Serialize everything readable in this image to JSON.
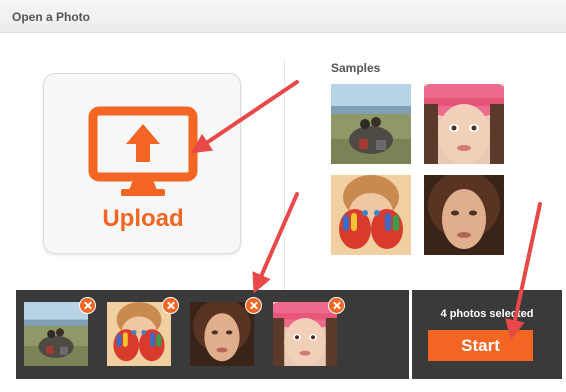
{
  "title": "Open a Photo",
  "upload": {
    "label": "Upload",
    "icon": "monitor-upload-icon",
    "accent": "#f26522"
  },
  "samples": {
    "label": "Samples",
    "items": [
      {
        "name": "sample-people-field"
      },
      {
        "name": "sample-girl-pink-hat"
      },
      {
        "name": "sample-painted-hands"
      },
      {
        "name": "sample-woman-portrait"
      }
    ]
  },
  "tray": {
    "photos": [
      {
        "name": "people-field"
      },
      {
        "name": "painted-hands"
      },
      {
        "name": "woman-portrait"
      },
      {
        "name": "girl-pink-hat"
      }
    ],
    "remove_icon": "close-icon"
  },
  "action": {
    "count_text": "4 photos selected",
    "start_label": "Start"
  },
  "colors": {
    "accent": "#f26522",
    "tray_bg": "#3a3a3a",
    "annotation_arrow": "#e84848"
  }
}
